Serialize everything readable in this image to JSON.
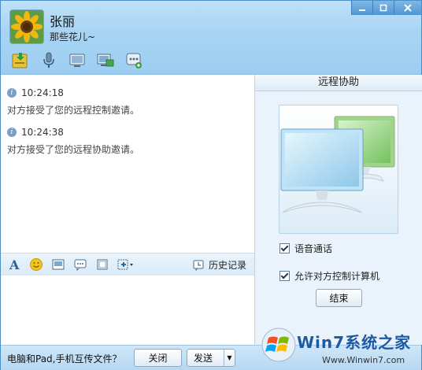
{
  "contact": {
    "name": "张丽",
    "signature": "那些花儿~"
  },
  "window_controls": {
    "minimize": "—",
    "maximize": "□",
    "close": "✕"
  },
  "toolbar": {
    "icons": [
      "file-transfer-icon",
      "voice-call-icon",
      "video-call-icon",
      "remote-desktop-icon",
      "more-apps-icon"
    ]
  },
  "messages": [
    {
      "time": "10:24:18",
      "text": "对方接受了您的远程控制邀请。"
    },
    {
      "time": "10:24:38",
      "text": "对方接受了您的远程协助邀请。"
    }
  ],
  "input_toolbar": {
    "icons": [
      "font-icon",
      "emoji-icon",
      "image-icon",
      "chat-bubble-icon",
      "screenshot-icon",
      "more-icon"
    ],
    "history_label": "历史记录"
  },
  "remote_panel": {
    "title": "远程协助",
    "option_voice": "语音通话",
    "option_voice_checked": true,
    "option_control": "允许对方控制计算机",
    "option_control_checked": true,
    "end_button": "结束"
  },
  "bottom_bar": {
    "prompt": "电脑和Pad,手机互传文件？",
    "close_button": "关闭",
    "send_button": "发送",
    "send_dropdown": "▼"
  },
  "watermark": {
    "title": "Win7系统之家",
    "url": "Www.Winwin7.com"
  },
  "colors": {
    "header": "#a9d5f4",
    "accent": "#4a8fc7",
    "panel": "#eaf3fb"
  }
}
